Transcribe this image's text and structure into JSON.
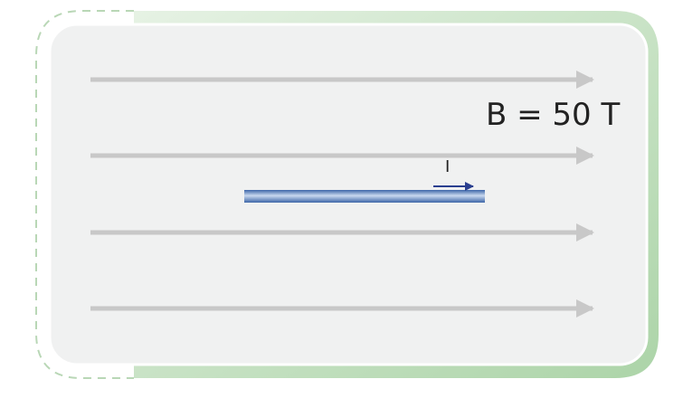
{
  "diagram": {
    "field_label": "B = 50 T",
    "current_label": "I",
    "field_line_count": 4,
    "colors": {
      "panel": "#f0f1f1",
      "frame_green": "#b5d9b3",
      "field_arrow": "#c8c8c8",
      "wire": "#4a77b4",
      "current_arrow": "#2a3f8f"
    }
  }
}
